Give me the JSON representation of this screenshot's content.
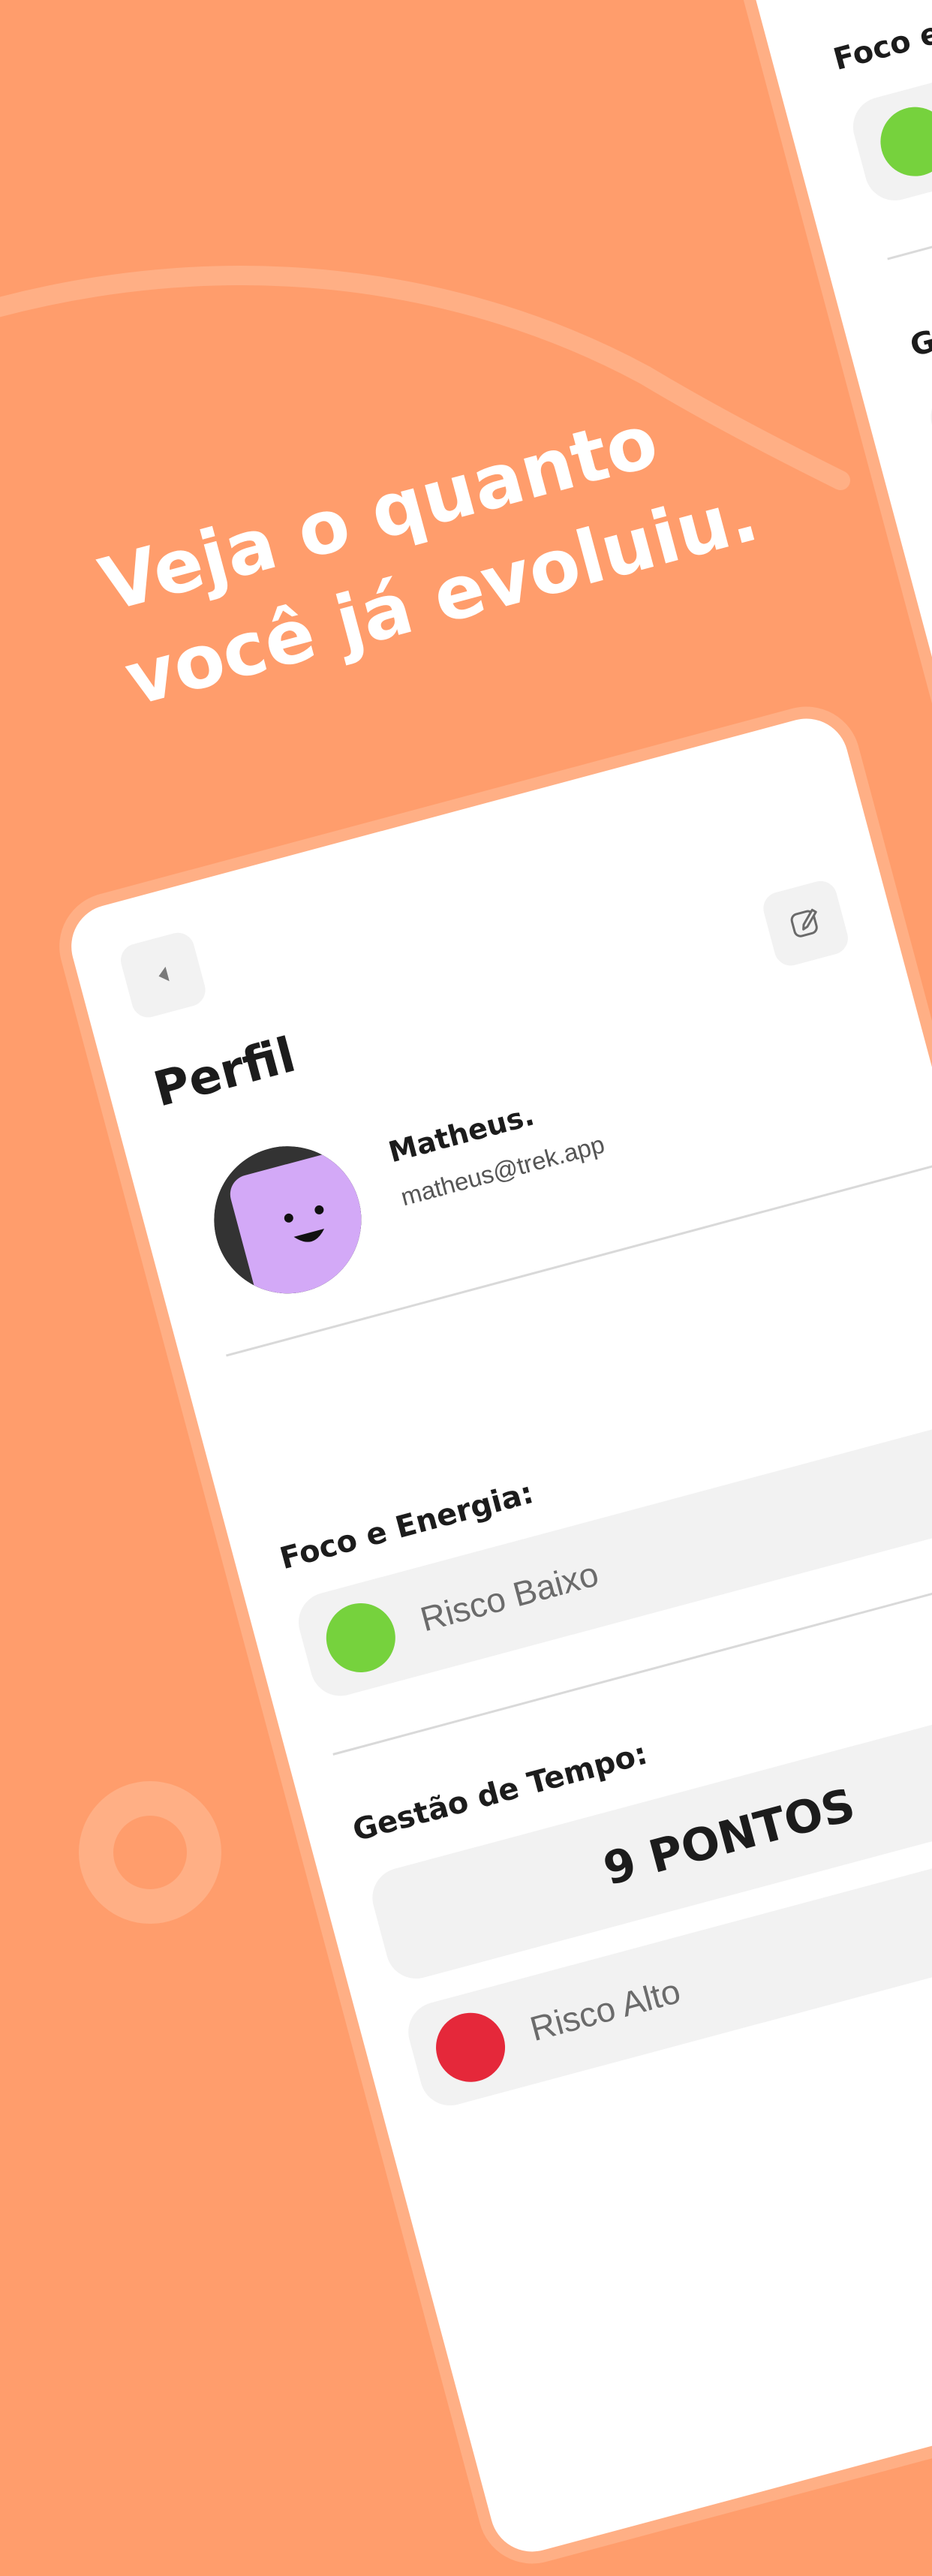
{
  "headline": {
    "line1": "Veja o quanto",
    "line2": "você já evoluiu."
  },
  "profile": {
    "title": "Perfil",
    "back_icon": "caret-left-icon",
    "edit_icon": "edit-pencil-icon",
    "user": {
      "name": "Matheus.",
      "email": "matheus@trek.app",
      "avatar": "smiley-avatar"
    },
    "focus": {
      "label": "Foco e Energia:",
      "risk_text": "Risco Baixo",
      "risk_color": "#76D23D"
    },
    "time": {
      "label": "Gestão de Tempo:",
      "points": "9 PONTOS",
      "risk_text": "Risco Alto",
      "risk_color": "#E5283A"
    }
  },
  "back_phone": {
    "label_focus": "Foco e Energia:",
    "label_time": "Gestão de Tempo:",
    "dot_color": "#76D23D"
  },
  "colors": {
    "background": "#FF9D6C",
    "accent_light": "#FFAF85",
    "avatar_face": "#D3A9F7",
    "avatar_hair": "#333333"
  }
}
